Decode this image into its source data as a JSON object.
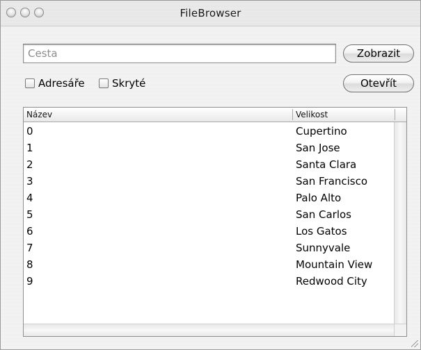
{
  "window": {
    "title": "FileBrowser"
  },
  "toolbar": {
    "path_placeholder": "Cesta",
    "path_value": "",
    "show_button": "Zobrazit",
    "open_button": "Otevřít",
    "dirs_checkbox": {
      "label": "Adresáře",
      "checked": false
    },
    "hidden_checkbox": {
      "label": "Skryté",
      "checked": false
    }
  },
  "table": {
    "columns": [
      "Název",
      "Velikost"
    ],
    "rows": [
      {
        "name": "0",
        "size": "Cupertino"
      },
      {
        "name": "1",
        "size": "San Jose"
      },
      {
        "name": "2",
        "size": "Santa Clara"
      },
      {
        "name": "3",
        "size": "San Francisco"
      },
      {
        "name": "4",
        "size": "Palo Alto"
      },
      {
        "name": "5",
        "size": "San Carlos"
      },
      {
        "name": "6",
        "size": "Los Gatos"
      },
      {
        "name": "7",
        "size": "Sunnyvale"
      },
      {
        "name": "8",
        "size": "Mountain View"
      },
      {
        "name": "9",
        "size": "Redwood City"
      }
    ]
  },
  "icons": [
    "close-button-icon",
    "minimize-button-icon",
    "zoom-button-icon",
    "resize-grip-icon"
  ]
}
